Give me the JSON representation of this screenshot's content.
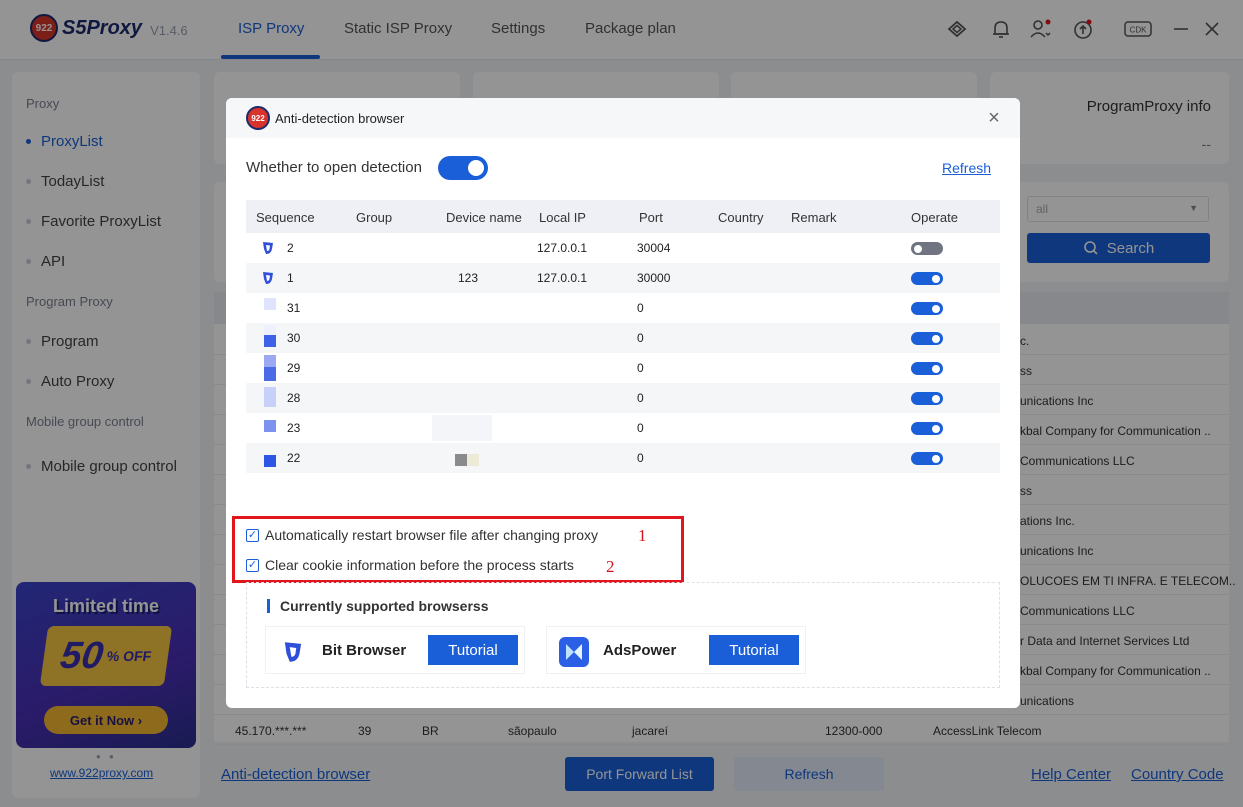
{
  "app": {
    "logo_text": "922",
    "name": "S5Proxy",
    "version": "V1.4.6"
  },
  "nav": {
    "tabs": [
      "ISP Proxy",
      "Static ISP Proxy",
      "Settings",
      "Package plan"
    ],
    "active_index": 0
  },
  "top_icons": [
    "link-icon",
    "bell-icon",
    "user-icon",
    "upgrade-icon",
    "cdk-icon",
    "minimize-icon",
    "close-icon"
  ],
  "top_cdk": "CDK",
  "sidebar": {
    "groups": [
      {
        "label": "Proxy",
        "items": [
          "ProxyList",
          "TodayList",
          "Favorite ProxyList",
          "API"
        ]
      },
      {
        "label": "Program Proxy",
        "items": [
          "Program",
          "Auto Proxy"
        ]
      },
      {
        "label": "Mobile group control",
        "items": [
          "Mobile group control"
        ]
      }
    ],
    "active_item": "ProxyList",
    "promo": {
      "title": "Limited time",
      "discount": "50",
      "off": "% OFF",
      "button": "Get it Now ›"
    },
    "link": "www.922proxy.com"
  },
  "stats": {
    "program_proxy_title": "ProgramProxy info",
    "program_proxy_value": "--"
  },
  "filter": {
    "select_value": "all",
    "search_label": "Search"
  },
  "bg_table": {
    "partial_isps": [
      "c.",
      "ss",
      "unications Inc",
      "kbal Company for Communication ..",
      "Communications LLC",
      "ss",
      "ations Inc.",
      "unications Inc",
      "OLUCOES EM TI INFRA. E TELECOM..",
      "Communications LLC",
      "r Data and Internet Services Ltd",
      "kbal Company for Communication ..",
      "unications"
    ],
    "last_row": {
      "ip": "45.170.***.***",
      "num": "39",
      "country": "BR",
      "state": "sãopaulo",
      "city": "jacareí",
      "zip": "12300-000",
      "isp": "AccessLink Telecom"
    }
  },
  "bottom": {
    "anti_detection_link": "Anti-detection browser",
    "port_forward_button": "Port Forward List",
    "refresh_button": "Refresh",
    "help_link": "Help Center",
    "country_link": "Country Code"
  },
  "modal": {
    "logo_text": "922",
    "title": "Anti-detection browser",
    "detection_label": "Whether to open detection",
    "detection_enabled": true,
    "refresh_link": "Refresh",
    "columns": [
      "Sequence",
      "Group",
      "Device name",
      "Local IP",
      "Port",
      "Country",
      "Remark",
      "Operate"
    ],
    "rows": [
      {
        "seq": "2",
        "group": "",
        "device": "",
        "ip": "127.0.0.1",
        "port": "30004",
        "country": "",
        "remark": "",
        "enabled": false,
        "icon": "bitbrowser-icon"
      },
      {
        "seq": "1",
        "group": "",
        "device": "123",
        "ip": "127.0.0.1",
        "port": "30000",
        "country": "",
        "remark": "",
        "enabled": true,
        "icon": "bitbrowser-icon"
      },
      {
        "seq": "31",
        "group": "",
        "device": "",
        "ip": "",
        "port": "0",
        "country": "",
        "remark": "",
        "enabled": true,
        "icon": "pixel-icon"
      },
      {
        "seq": "30",
        "group": "",
        "device": "",
        "ip": "",
        "port": "0",
        "country": "",
        "remark": "",
        "enabled": true,
        "icon": "pixel-icon"
      },
      {
        "seq": "29",
        "group": "",
        "device": "",
        "ip": "",
        "port": "0",
        "country": "",
        "remark": "",
        "enabled": true,
        "icon": "pixel-icon"
      },
      {
        "seq": "28",
        "group": "",
        "device": "",
        "ip": "",
        "port": "0",
        "country": "",
        "remark": "",
        "enabled": true,
        "icon": "pixel-icon"
      },
      {
        "seq": "23",
        "group": "",
        "device": "",
        "ip": "",
        "port": "0",
        "country": "",
        "remark": "",
        "enabled": true,
        "icon": "pixel-icon"
      },
      {
        "seq": "22",
        "group": "",
        "device": "",
        "ip": "",
        "port": "0",
        "country": "",
        "remark": "",
        "enabled": true,
        "icon": "pixel-icon"
      }
    ],
    "options": [
      {
        "label": "Automatically restart browser file after changing proxy",
        "checked": true,
        "marker": "1"
      },
      {
        "label": "Clear cookie information before the process starts",
        "checked": true,
        "marker": "2"
      }
    ],
    "supported_title": "Currently supported browserss",
    "browsers": [
      {
        "name": "Bit Browser",
        "button": "Tutorial",
        "icon": "bitbrowser-icon"
      },
      {
        "name": "AdsPower",
        "button": "Tutorial",
        "icon": "adspower-icon"
      }
    ]
  },
  "colors": {
    "accent": "#1a5fd8",
    "highlight_box": "#e0161c",
    "toggle_off": "#6f7480"
  }
}
